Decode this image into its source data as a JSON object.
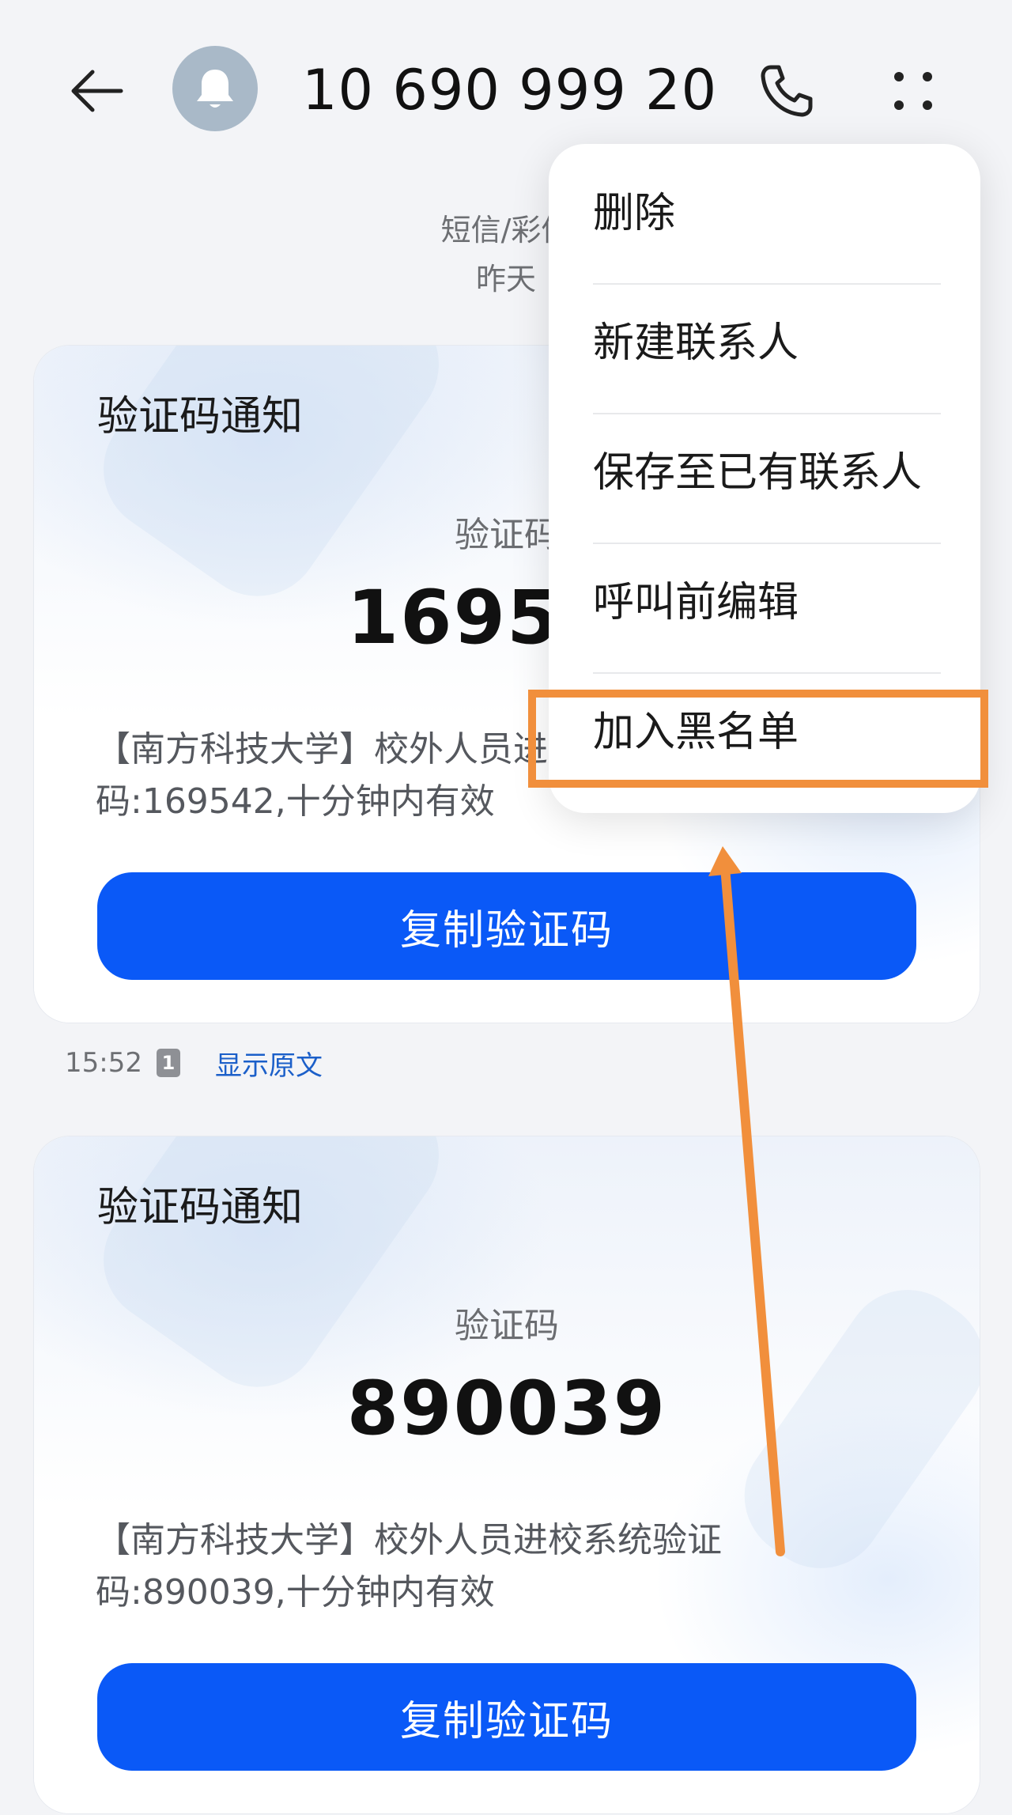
{
  "header": {
    "back_icon": "arrow-left-icon",
    "avatar_icon": "bell-icon",
    "title": "10 690 999 20…",
    "call_icon": "phone-icon",
    "more_icon": "more-dots-icon"
  },
  "conversation": {
    "channel": "短信/彩信",
    "date": "昨天"
  },
  "messages": [
    {
      "card_title": "验证码通知",
      "code_label": "验证码",
      "code": "169542",
      "text": "【南方科技大学】校外人员进校系统验证码:169542,十分钟内有效",
      "copy_label": "复制验证码"
    },
    {
      "card_title": "验证码通知",
      "code_label": "验证码",
      "code": "890039",
      "text": "【南方科技大学】校外人员进校系统验证码:890039,十分钟内有效",
      "copy_label": "复制验证码"
    }
  ],
  "meta_row": {
    "time": "15:52",
    "sim": "1",
    "show_original": "显示原文"
  },
  "menu": {
    "items": [
      {
        "label": "删除"
      },
      {
        "label": "新建联系人"
      },
      {
        "label": "保存至已有联系人"
      },
      {
        "label": "呼叫前编辑"
      },
      {
        "label": "加入黑名单"
      }
    ]
  },
  "colors": {
    "accent": "#0a59f7",
    "annotation": "#f18f3c",
    "link": "#1b5fc9"
  }
}
